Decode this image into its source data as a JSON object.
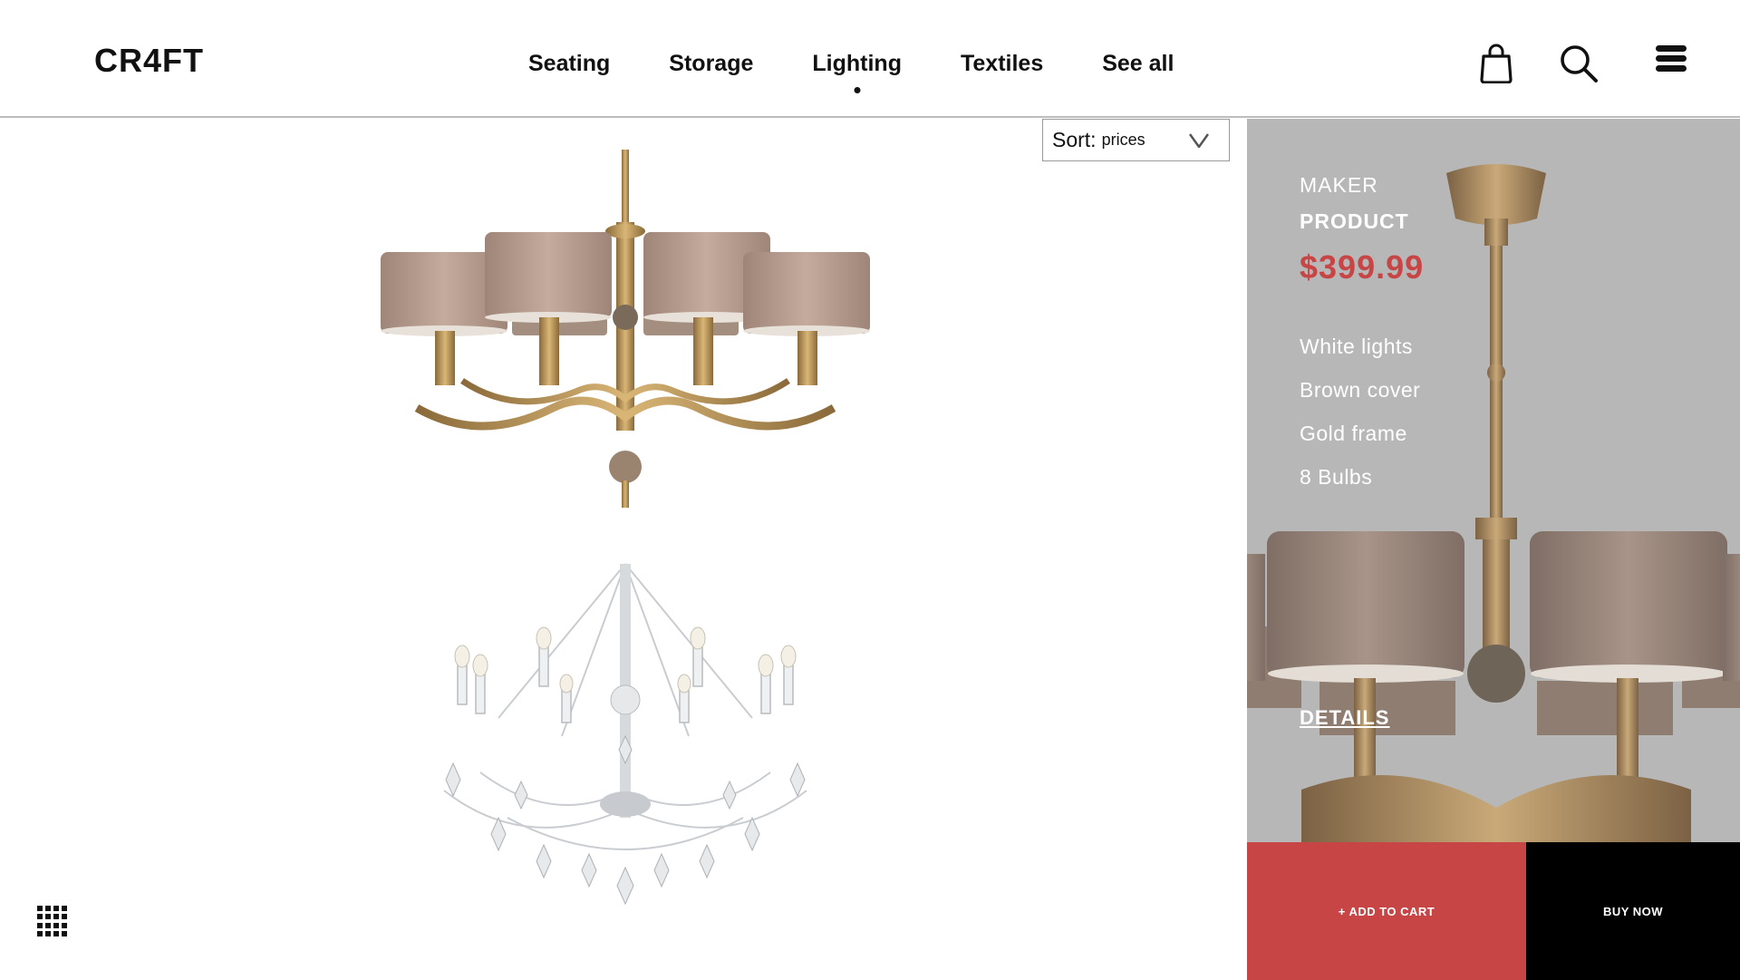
{
  "header": {
    "logo": "CR4FT",
    "nav": [
      {
        "label": "Seating",
        "active": false
      },
      {
        "label": "Storage",
        "active": false
      },
      {
        "label": "Lighting",
        "active": true
      },
      {
        "label": "Textiles",
        "active": false
      },
      {
        "label": "See all",
        "active": false
      }
    ],
    "icons": [
      "shopping-bag-icon",
      "search-icon",
      "menu-icon"
    ]
  },
  "sort": {
    "label": "Sort:",
    "value": "prices",
    "icon": "chevron-down-icon"
  },
  "products": [
    {
      "name": "brass-chandelier",
      "image": "bronze chandelier with brown fabric shades"
    },
    {
      "name": "crystal-chandelier",
      "image": "crystal chandelier with candle bulbs"
    }
  ],
  "view_toggle_icon": "grid-icon",
  "detail_panel": {
    "maker": "MAKER",
    "product": "PRODUCT",
    "price": "$399.99",
    "features": [
      "White lights",
      "Brown cover",
      "Gold frame",
      "8 Bulbs"
    ],
    "details_link": "DETAILS",
    "add_to_cart": "+ ADD TO CART",
    "buy_now": "BUY NOW"
  },
  "colors": {
    "accent": "#c84545",
    "panel_bg": "#b8b7b8",
    "text": "#111111",
    "buy_bg": "#000000"
  }
}
